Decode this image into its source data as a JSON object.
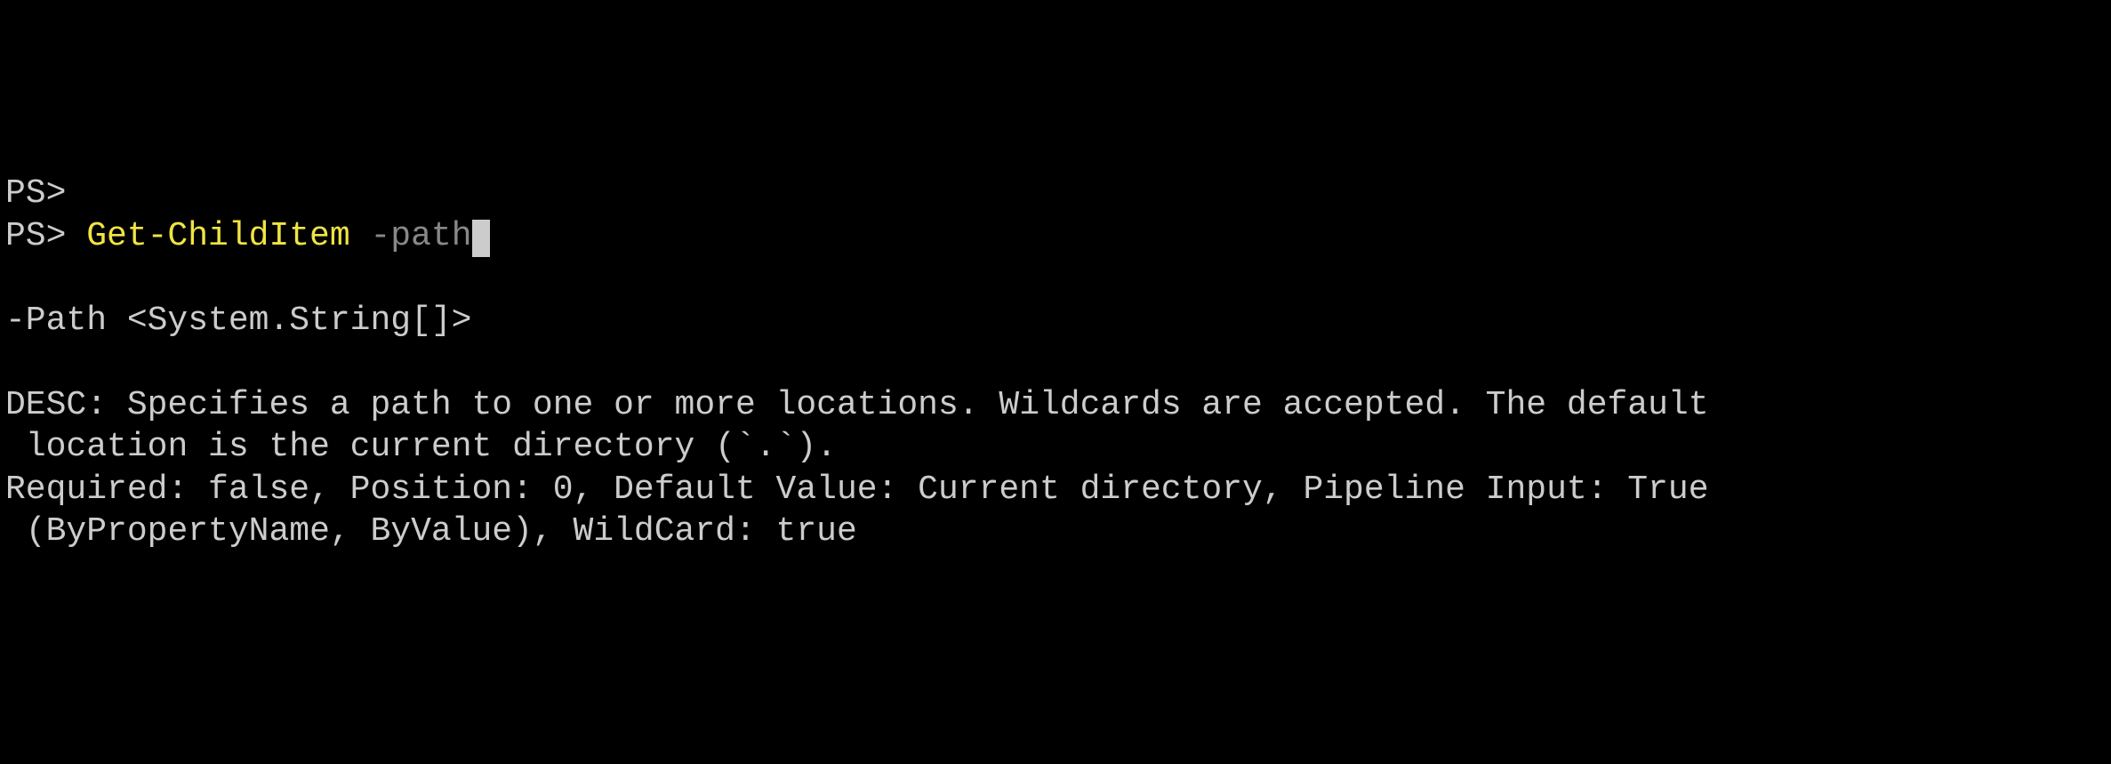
{
  "terminal": {
    "line1": {
      "prompt": "PS>"
    },
    "line2": {
      "prompt": "PS> ",
      "cmdlet": "Get-ChildItem",
      "space": " ",
      "param": "-path"
    },
    "help": {
      "signature": "-Path <System.String[]>",
      "desc_label": "DESC: ",
      "desc_text": "Specifies a path to one or more locations. Wildcards are accepted. The default",
      "desc_text2": " location is the current directory (`.`).",
      "meta": "Required: false, Position: 0, Default Value: Current directory, Pipeline Input: True",
      "meta2": " (ByPropertyName, ByValue), WildCard: true"
    }
  }
}
